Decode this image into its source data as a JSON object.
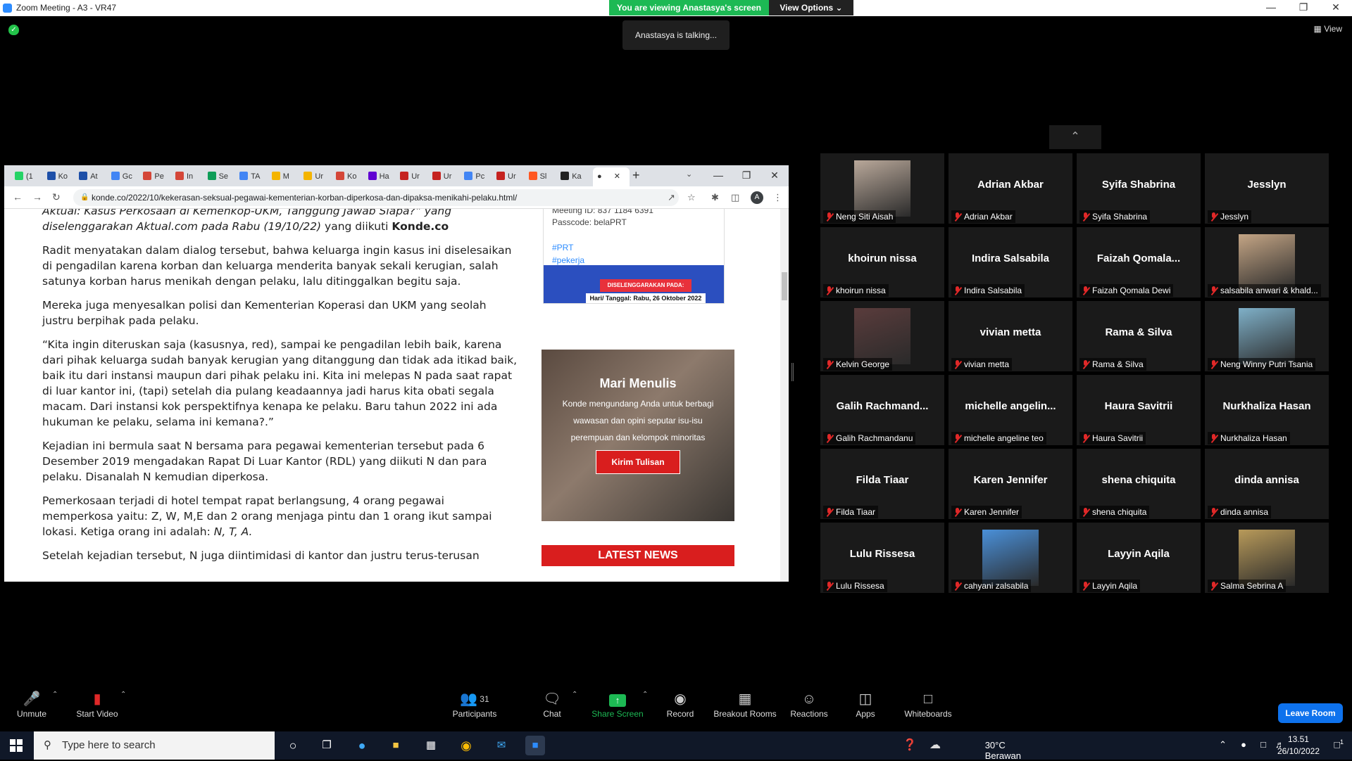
{
  "window": {
    "title": "Zoom Meeting - A3 - VR47",
    "viewing_banner": "You are viewing Anastasya's screen",
    "view_options": "View Options",
    "talking": "Anastasya is talking...",
    "view_button": "View"
  },
  "browser": {
    "url": "konde.co/2022/10/kekerasan-seksual-pegawai-kementerian-korban-diperkosa-dan-dipaksa-menikahi-pelaku.html/",
    "tabs": [
      {
        "label": "(1",
        "color": "#25d366"
      },
      {
        "label": "Ko",
        "color": "#1d4fa8"
      },
      {
        "label": "At",
        "color": "#1d4fa8"
      },
      {
        "label": "Gc",
        "color": "#4285f4"
      },
      {
        "label": "Pe",
        "color": "#d44638"
      },
      {
        "label": "In",
        "color": "#d44638"
      },
      {
        "label": "Se",
        "color": "#0f9d58"
      },
      {
        "label": "TA",
        "color": "#4285f4"
      },
      {
        "label": "M",
        "color": "#f4b400"
      },
      {
        "label": "Ur",
        "color": "#f4b400"
      },
      {
        "label": "Ko",
        "color": "#d44638"
      },
      {
        "label": "Ha",
        "color": "#6001d2"
      },
      {
        "label": "Ur",
        "color": "#c5221f"
      },
      {
        "label": "Ur",
        "color": "#c5221f"
      },
      {
        "label": "Pc",
        "color": "#4285f4"
      },
      {
        "label": "Ur",
        "color": "#c5221f"
      },
      {
        "label": "Sl",
        "color": "#ff5722"
      },
      {
        "label": "Ka",
        "color": "#222222"
      }
    ],
    "profile_initial": "A"
  },
  "article": {
    "lead_italic": "Aktual: Kasus Perkosaan di Kemenkop-UKM, Tanggung Jawab Siapa?” yang diselenggarakan Aktual.com pada Rabu (19/10/22)",
    "lead_rest": " yang diikuti ",
    "lead_bold": "Konde.co",
    "p1": "Radit menyatakan dalam dialog tersebut, bahwa keluarga ingin kasus ini diselesaikan di pengadilan karena korban dan keluarga menderita banyak sekali kerugian, salah satunya korban harus menikah dengan pelaku, lalu ditinggalkan begitu saja.",
    "p2": "Mereka juga menyesalkan polisi dan Kementerian Koperasi dan UKM yang seolah justru berpihak pada pelaku.",
    "p3": "“Kita ingin diteruskan saja (kasusnya, red), sampai ke pengadilan lebih baik, karena dari pihak keluarga sudah banyak kerugian yang ditanggung dan tidak ada itikad baik, baik itu dari instansi maupun dari pihak pelaku ini. Kita ini melepas N pada saat rapat di luar kantor ini, (tapi) setelah dia pulang keadaannya jadi harus kita obati segala macam. Dari instansi kok perspektifnya kenapa ke pelaku. Baru tahun 2022 ini ada hukuman ke pelaku, selama ini kemana?.”",
    "p4": "Kejadian ini bermula saat N bersama para pegawai kementerian tersebut pada 6 Desember 2019 mengadakan Rapat Di Luar Kantor (RDL) yang diikuti N dan para pelaku. Disanalah N kemudian diperkosa.",
    "p5_start": "Pemerkosaan terjadi di hotel tempat rapat berlangsung, 4 orang pegawai memperkosa yaitu: Z, W, M,E dan 2 orang menjaga pintu dan 1 orang ikut sampai lokasi. Ketiga orang ini adalah: ",
    "p5_italic": "N, T, A.",
    "p6": "Setelah kejadian tersebut, N juga diintimidasi di kantor dan justru terus-terusan"
  },
  "sidebar": {
    "meeting_id": "Meeting ID: 837 1184 6391",
    "passcode": "Passcode: belaPRT",
    "tag1": "#PRT",
    "tag2": "#pekerja",
    "poster_banner": "DISELENGGARAKAN PADA:",
    "poster_date": "Hari/ Tanggal: Rabu, 26 Oktober 2022",
    "menulis_title": "Mari Menulis",
    "menulis_text": "Konde mengundang Anda untuk berbagi wawasan dan opini seputar isu-isu perempuan dan kelompok minoritas",
    "kirim": "Kirim Tulisan",
    "latest": "LATEST NEWS"
  },
  "participants": [
    {
      "big": "",
      "label": "Neng Siti Aisah",
      "photo": "#b9a89a"
    },
    {
      "big": "Adrian Akbar",
      "label": "Adrian Akbar"
    },
    {
      "big": "Syifa Shabrina",
      "label": "Syifa Shabrina"
    },
    {
      "big": "Jesslyn",
      "label": "Jesslyn"
    },
    {
      "big": "khoirun nissa",
      "label": "khoirun nissa"
    },
    {
      "big": "Indira Salsabila",
      "label": "Indira Salsabila"
    },
    {
      "big": "Faizah  Qomala...",
      "label": "Faizah Qomala Dewi"
    },
    {
      "big": "",
      "label": "salsabila anwari & khald...",
      "photo": "#c4a585"
    },
    {
      "big": "",
      "label": "Kelvin George",
      "photo": "#5a3c3c"
    },
    {
      "big": "vivian metta",
      "label": "vivian metta"
    },
    {
      "big": "Rama & Silva",
      "label": "Rama & Silva"
    },
    {
      "big": "",
      "label": "Neng Winny Putri Tsania",
      "photo": "#7fb0c8"
    },
    {
      "big": "Galih  Rachmand...",
      "label": "Galih Rachmandanu"
    },
    {
      "big": "michelle  angelin...",
      "label": "michelle angeline teo"
    },
    {
      "big": "Haura Savitrii",
      "label": "Haura Savitrii"
    },
    {
      "big": "Nurkhaliza Hasan",
      "label": "Nurkhaliza Hasan"
    },
    {
      "big": "Filda Tiaar",
      "label": "Filda Tiaar"
    },
    {
      "big": "Karen Jennifer",
      "label": "Karen Jennifer"
    },
    {
      "big": "shena chiquita",
      "label": "shena chiquita"
    },
    {
      "big": "dinda annisa",
      "label": "dinda annisa"
    },
    {
      "big": "Lulu Rissesa",
      "label": "Lulu Rissesa"
    },
    {
      "big": "",
      "label": "cahyani zalsabila",
      "photo": "#4a90d9"
    },
    {
      "big": "Layyin Aqila",
      "label": "Layyin Aqila"
    },
    {
      "big": "",
      "label": "Salma Sebrina A",
      "photo": "#b89a5a"
    }
  ],
  "toolbar": {
    "unmute": "Unmute",
    "start_video": "Start Video",
    "participants": "Participants",
    "participant_count": "31",
    "chat": "Chat",
    "share": "Share Screen",
    "record": "Record",
    "breakout": "Breakout Rooms",
    "reactions": "Reactions",
    "apps": "Apps",
    "whiteboards": "Whiteboards",
    "leave": "Leave Room"
  },
  "taskbar": {
    "search_placeholder": "Type here to search",
    "weather": "30°C  Berawan",
    "time": "13.51",
    "date": "26/10/2022",
    "notif_count": "1"
  }
}
